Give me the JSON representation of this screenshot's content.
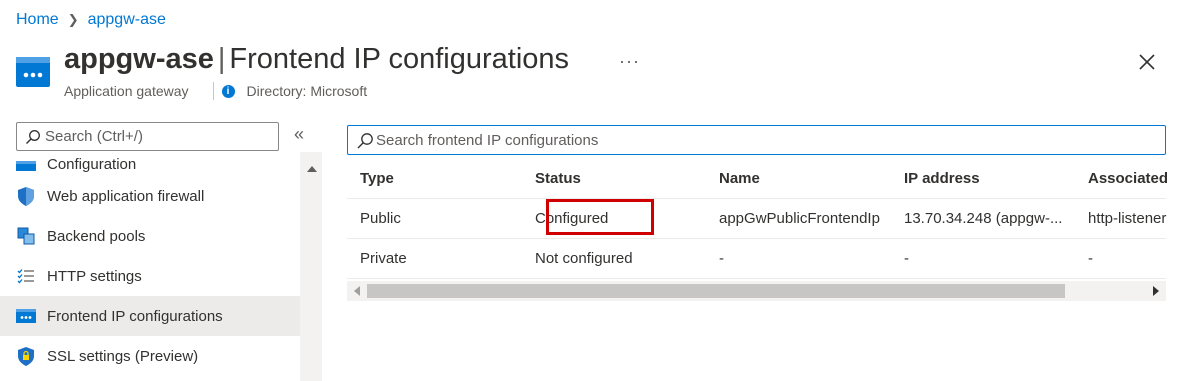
{
  "breadcrumb": {
    "home": "Home",
    "resource": "appgw-ase"
  },
  "header": {
    "resource_name": "appgw-ase",
    "page_title": "Frontend IP configurations",
    "resource_type": "Application gateway",
    "directory": "Directory: Microsoft",
    "more_label": "···"
  },
  "sidebar": {
    "search_placeholder": "Search (Ctrl+/)",
    "collapse_label": "«",
    "items": [
      {
        "label": "Configuration",
        "icon": "configuration-icon"
      },
      {
        "label": "Web application firewall",
        "icon": "shield-icon"
      },
      {
        "label": "Backend pools",
        "icon": "backend-pools-icon"
      },
      {
        "label": "HTTP settings",
        "icon": "list-settings-icon"
      },
      {
        "label": "Frontend IP configurations",
        "icon": "frontend-ip-icon",
        "active": true
      },
      {
        "label": "SSL settings (Preview)",
        "icon": "ssl-shield-icon"
      }
    ]
  },
  "main": {
    "search_placeholder": "Search frontend IP configurations",
    "columns": [
      "Type",
      "Status",
      "Name",
      "IP address",
      "Associated"
    ],
    "rows": [
      {
        "type": "Public",
        "status": "Configured",
        "name": "appGwPublicFrontendIp",
        "ip": "13.70.34.248 (appgw-...",
        "associated": "http-listener"
      },
      {
        "type": "Private",
        "status": "Not configured",
        "name": "-",
        "ip": "-",
        "associated": "-"
      }
    ]
  },
  "colors": {
    "accent": "#0078d4",
    "highlight": "#d00000",
    "active_bg": "#edebe9"
  }
}
